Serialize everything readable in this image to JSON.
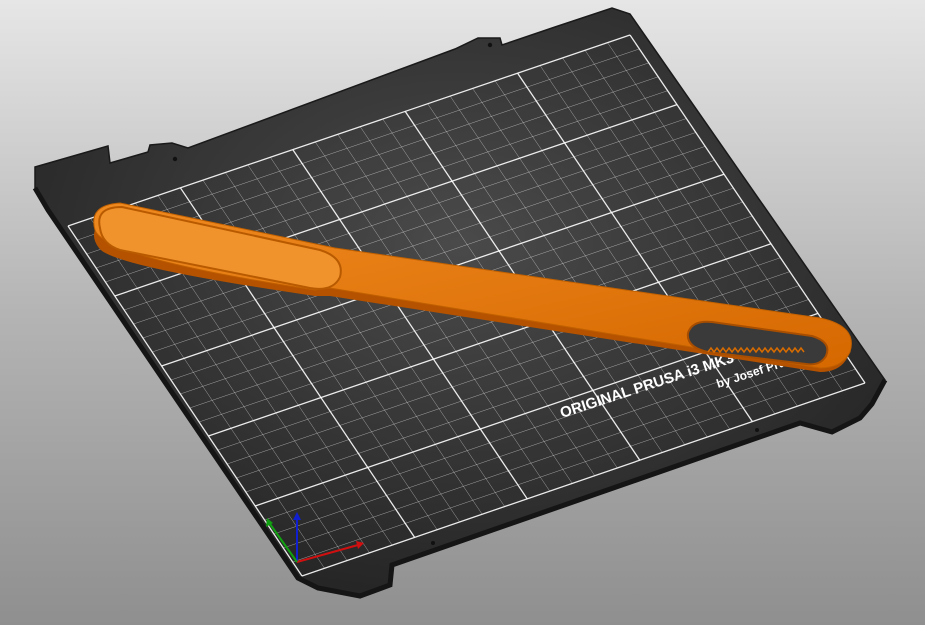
{
  "viewport": {
    "background_top": "#e6e6e6",
    "background_bottom": "#8f8f8f"
  },
  "bed": {
    "plate_color": "#2b2b2b",
    "grid_color": "#ffffff",
    "label_line1": "ORIGINAL PRUSA i3  MK3",
    "label_line2": "by Josef Prusa"
  },
  "model": {
    "color": "#e07000",
    "shape": "paddle-handle"
  },
  "axes_gizmo": {
    "x_color": "#d01010",
    "y_color": "#10a010",
    "z_color": "#1020d0"
  }
}
